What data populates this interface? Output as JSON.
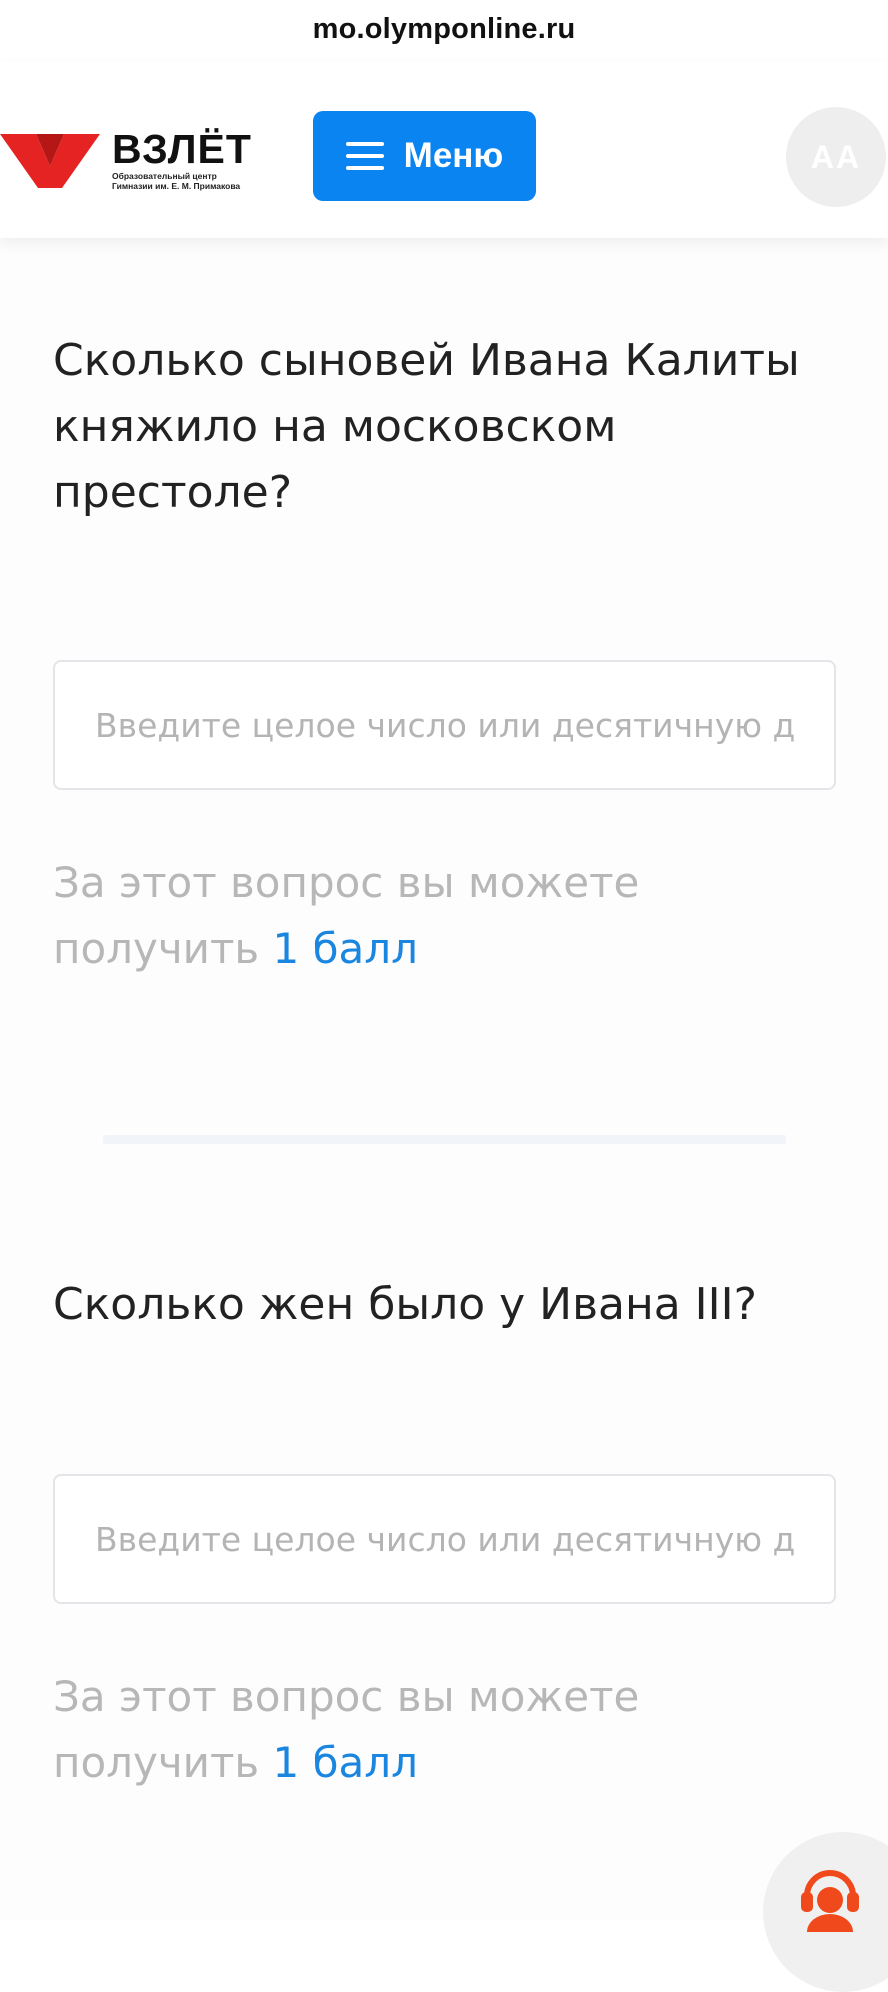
{
  "browser": {
    "url": "mo.olymponline.ru"
  },
  "header": {
    "logo": {
      "title": "ВЗЛЁТ",
      "subtitle_line1": "Образовательный центр",
      "subtitle_line2": "Гимназии им. Е. М. Примакова"
    },
    "menu_label": "Меню",
    "avatar_initials": "AA"
  },
  "questions": [
    {
      "title": "Сколько сыновей Ивана Калиты княжило на московском престоле?",
      "input_placeholder": "Введите целое число или десятичную дробь",
      "input_value": "",
      "points_prefix": "За этот вопрос вы можете получить",
      "points_value": "1 балл"
    },
    {
      "title": "Сколько жен было у Ивана III?",
      "input_placeholder": "Введите целое число или десятичную дробь",
      "input_value": "",
      "points_prefix": "За этот вопрос вы можете получить",
      "points_value": "1 балл"
    }
  ],
  "colors": {
    "accent": "#0a84f0",
    "points_accent": "#1a86df",
    "logo_red": "#e52323"
  },
  "icons": {
    "menu": "hamburger-icon",
    "support": "support-chat-icon"
  }
}
